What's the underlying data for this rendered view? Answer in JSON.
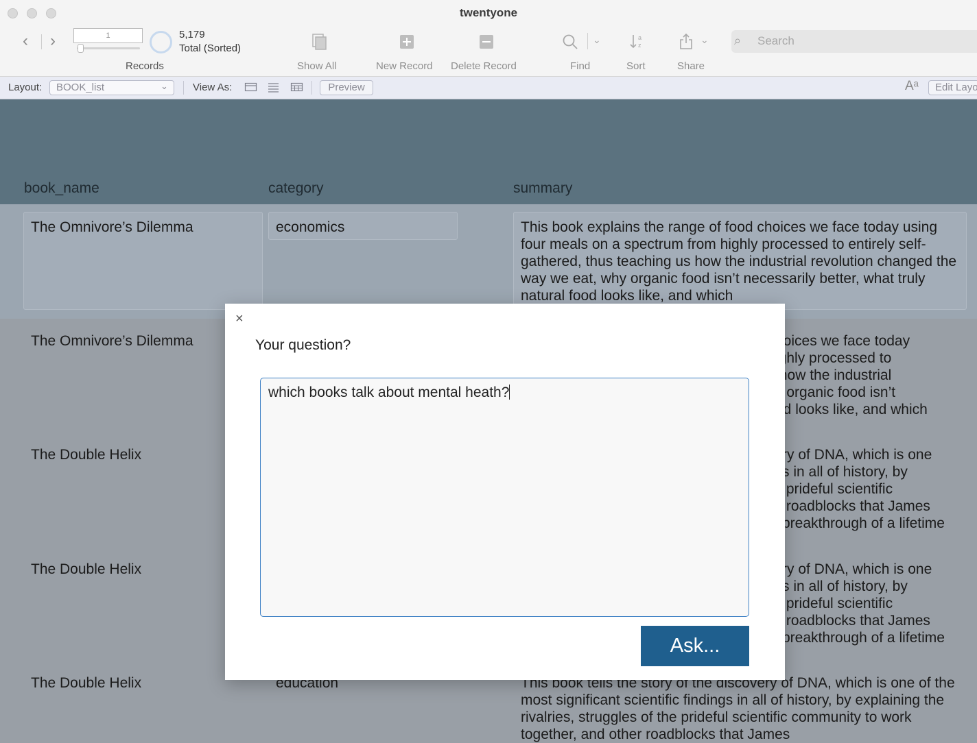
{
  "window": {
    "title": "twentyone"
  },
  "toolbar": {
    "record_number": "1",
    "record_count": "5,179",
    "record_status": "Total (Sorted)",
    "records_label": "Records",
    "show_all_label": "Show All",
    "new_record_label": "New Record",
    "delete_record_label": "Delete Record",
    "find_label": "Find",
    "sort_label": "Sort",
    "share_label": "Share",
    "search_placeholder": "Search"
  },
  "layout_bar": {
    "layout_label": "Layout:",
    "layout_value": "BOOK_list",
    "view_as_label": "View As:",
    "preview_label": "Preview",
    "font_icon_text": "Aᵃ",
    "edit_layout_label": "Edit Layout"
  },
  "columns": {
    "book_name": "book_name",
    "category": "category",
    "summary": "summary"
  },
  "records": [
    {
      "book_name": "The Omnivore’s Dilemma",
      "category": "economics",
      "summary": "This book explains the range of food choices we face today using four meals on a spectrum from highly processed to entirely self-gathered, thus teaching us how the industrial revolution changed the way we eat, why organic food isn’t necessarily better, what truly natural food looks like, and which"
    },
    {
      "book_name": "The Omnivore’s Dilemma",
      "summary_visible": "hoices we face today\nighly processed to\n how the industrial\ny organic food isn’t\nod looks like, and which"
    },
    {
      "book_name": "The Double Helix",
      "summary_visible": "ry of DNA, which is one\ns in all of history, by\n prideful scientific\n roadblocks that James\nbreakthrough of a lifetime"
    },
    {
      "book_name": "The Double Helix",
      "summary_visible": "ry of DNA, which is one\ns in all of history, by\n prideful scientific\n roadblocks that James\nbreakthrough of a lifetime"
    },
    {
      "book_name": "The Double Helix",
      "category": "education",
      "summary": "This book tells the story of the discovery of DNA, which is one of the most significant scientific findings in all of history, by explaining the rivalries, struggles of the prideful scientific community to work together, and other roadblocks that James"
    }
  ],
  "dialog": {
    "close_glyph": "×",
    "prompt": "Your question?",
    "question_text": "which books talk about mental heath?",
    "ask_label": "Ask..."
  },
  "colors": {
    "header_band": "#5b727f",
    "ask_button": "#1f5f8e",
    "textarea_focus": "#3b7fc4"
  }
}
